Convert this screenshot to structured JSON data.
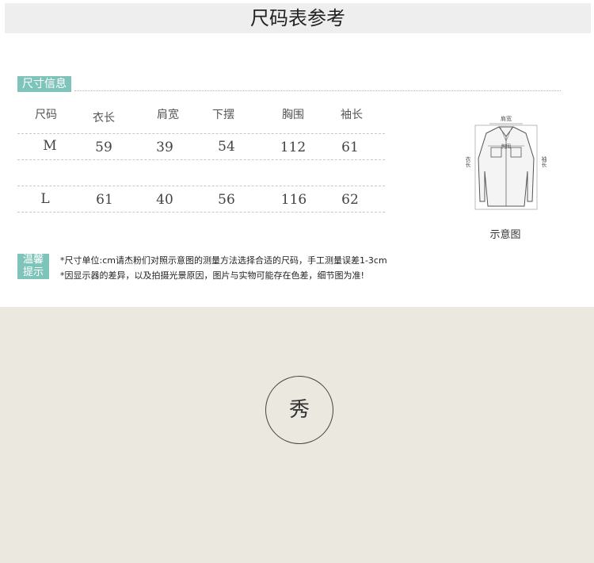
{
  "header": {
    "title": "尺码表参考"
  },
  "size_info": {
    "tag": "尺寸信息",
    "columns": [
      "尺码",
      "衣长",
      "肩宽",
      "下摆",
      "胸围",
      "袖长"
    ],
    "rows": [
      [
        "M",
        "59",
        "39",
        "54",
        "112",
        "61"
      ],
      [
        "L",
        "61",
        "40",
        "56",
        "116",
        "62"
      ]
    ]
  },
  "diagram": {
    "caption": "示意图",
    "label_top": "肩宽",
    "label_left": "衣长",
    "label_right": "袖长",
    "label_chest": "胸围"
  },
  "tips": {
    "badge_line1": "温馨",
    "badge_line2": "提示",
    "line1": "*尺寸单位:cm请杰粉们对照示意图的测量方法选择合适的尺码，手工测量误差1-3cm",
    "line2": "*因显示器的差异，以及拍摄光景原因，图片与实物可能存在色差，细节图为准!"
  },
  "showcase": {
    "label": "秀"
  }
}
